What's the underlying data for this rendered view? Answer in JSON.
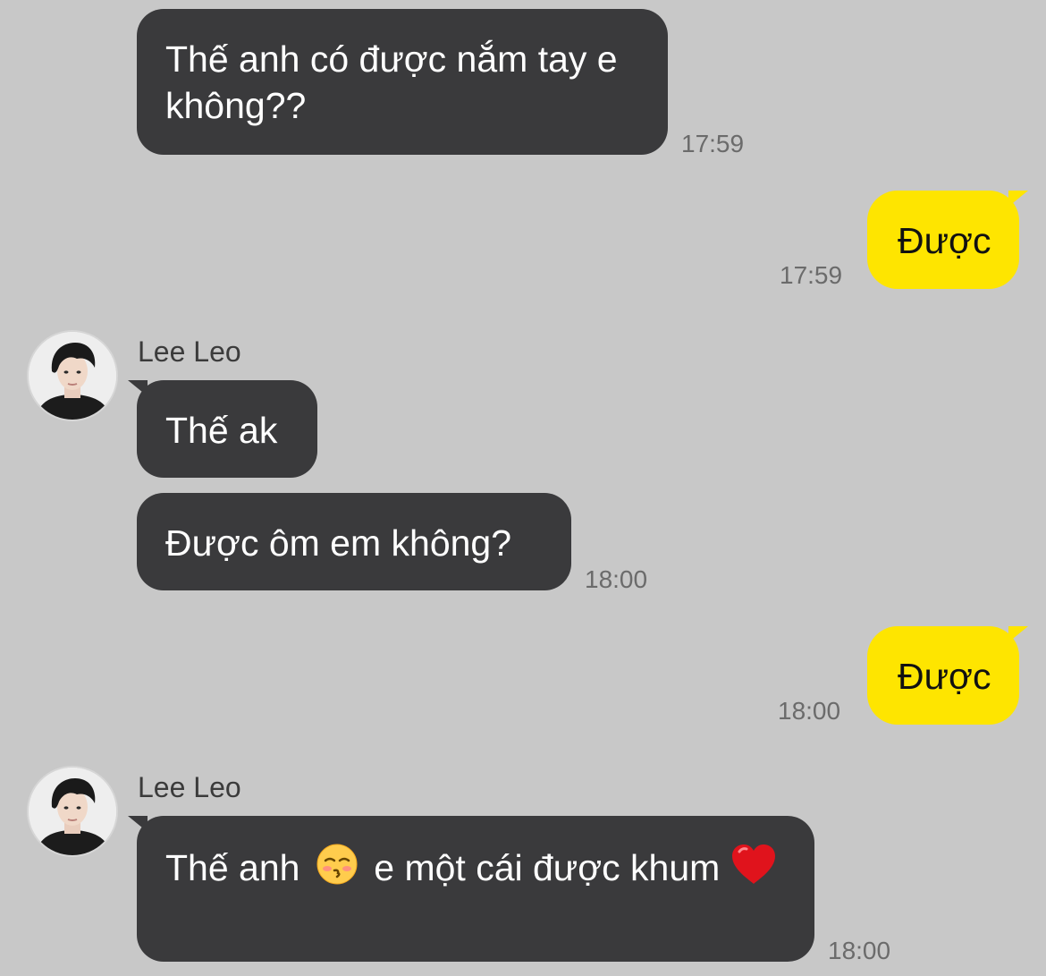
{
  "chat": {
    "messages": [
      {
        "sender": "other",
        "text": "Thế anh có được nắm tay e không??",
        "time": "17:59"
      },
      {
        "sender": "me",
        "text": "Được",
        "time": "17:59"
      },
      {
        "sender": "other",
        "name": "Lee Leo",
        "text": "Thế ak"
      },
      {
        "sender": "other",
        "text": "Được ôm em không?",
        "time": "18:00"
      },
      {
        "sender": "me",
        "text": "Được",
        "time": "18:00"
      },
      {
        "sender": "other",
        "name": "Lee Leo",
        "text_before": "Thế anh",
        "emoji": "kissing-face-with-closed-eyes",
        "text_after": "e một cái được khum",
        "emoji_end": "red-heart",
        "time": "18:00"
      }
    ]
  },
  "colors": {
    "background": "#c8c8c8",
    "incoming_bubble": "#3a3a3c",
    "outgoing_bubble": "#fee500",
    "timestamp": "#6b6b6b"
  }
}
